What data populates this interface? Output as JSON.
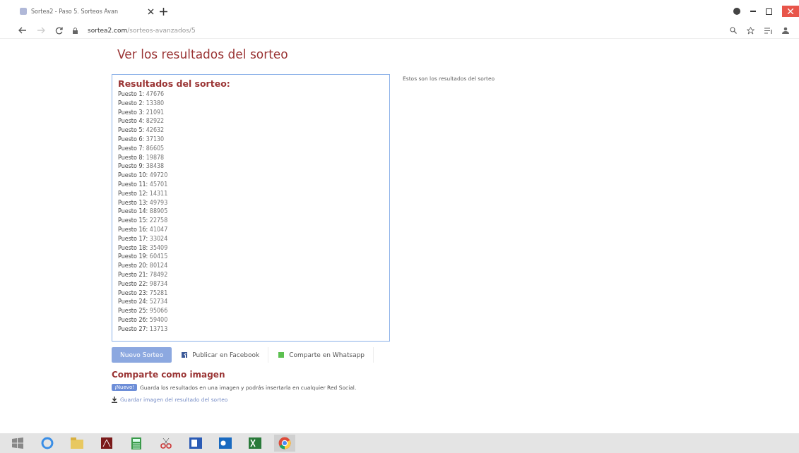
{
  "browser": {
    "tab_title": "Sortea2 - Paso 5. Sorteos Avan",
    "url_host": "sortea2.com",
    "url_path": "/sorteos-avanzados/5"
  },
  "page": {
    "heading": "Ver los resultados del sorteo",
    "results": {
      "title": "Resultados del sorteo:",
      "rows": [
        "**Puesto 1:** 47676",
        "**Puesto 2:** 13380",
        "**Puesto 3:** 21091",
        "**Puesto 4:** 82922",
        "**Puesto 5:** 42632",
        "**Puesto 6:** 37130",
        "**Puesto 7:** 86605",
        "**Puesto 8:** 19878",
        "**Puesto 9:** 38438",
        "**Puesto 10:** 49720",
        "**Puesto 11:** 45701",
        "**Puesto 12:** 14311",
        "**Puesto 13:** 49793",
        "**Puesto 14:** 88905",
        "**Puesto 15:** 22758",
        "**Puesto 16:** 41047",
        "**Puesto 17:** 33024",
        "**Puesto 18:** 35409",
        "**Puesto 19:** 60415",
        "**Puesto 20:** 80124",
        "**Puesto 21:** 78492",
        "**Puesto 22:** 98734",
        "**Puesto 23:** 75281",
        "**Puesto 24:** 52734",
        "**Puesto 25:** 95066",
        "**Puesto 26:** 59400",
        "**Puesto 27:** 13713"
      ]
    },
    "side_note": "Estos son los resultados del sorteo",
    "actions": [
      {
        "kind": "primary",
        "label": "Nuevo Sorteo"
      },
      {
        "kind": "facebook",
        "label": "Publicar en Facebook"
      },
      {
        "kind": "whatsapp",
        "label": "Comparte en Whatsapp"
      }
    ],
    "share": {
      "title": "Comparte como imagen",
      "badge": "¡Nuevo!",
      "text": "Guarda los resultados en una imagen y podrás insertarla en cualquier Red Social.",
      "link": "Guardar imagen del resultado del sorteo"
    }
  }
}
